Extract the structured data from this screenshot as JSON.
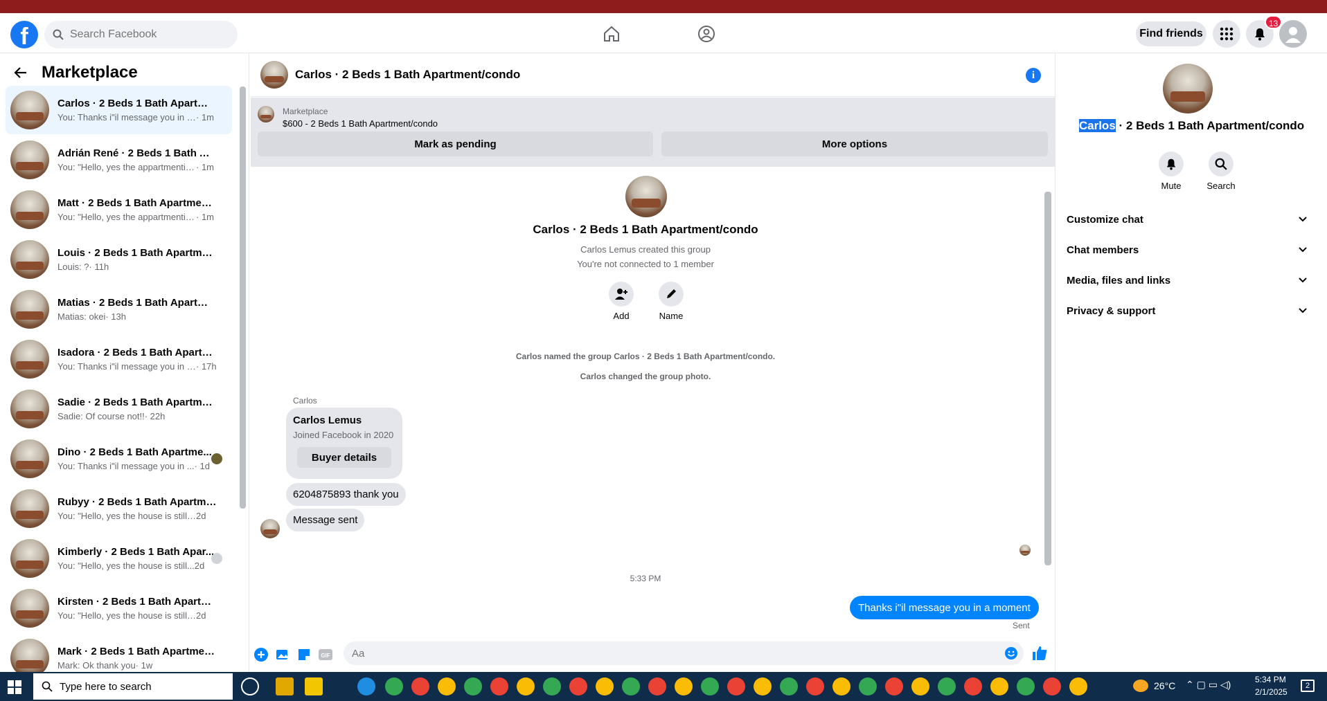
{
  "header": {
    "logo": "f",
    "search_placeholder": "Search Facebook",
    "find_friends": "Find friends",
    "notif_count": "13"
  },
  "sidebar": {
    "title": "Marketplace",
    "items": [
      {
        "name": "Carlos · 2 Beds 1 Bath Apartmen...",
        "preview": "You: Thanks i\"il message you in a ...",
        "time": " · 1m"
      },
      {
        "name": "Adrián René · 2 Beds 1 Bath Apa...",
        "preview": "You: \"Hello, yes the appartmentis s...",
        "time": " · 1m"
      },
      {
        "name": "Matt · 2 Beds 1 Bath Apartment/...",
        "preview": "You: \"Hello, yes the appartmentis s...",
        "time": " · 1m"
      },
      {
        "name": "Louis · 2 Beds 1 Bath Apartment...",
        "preview": "Louis: ?",
        "time": " · 11h"
      },
      {
        "name": "Matias · 2 Beds 1 Bath Apartme...",
        "preview": "Matias: okei",
        "time": " · 13h"
      },
      {
        "name": "Isadora · 2 Beds 1 Bath Apartme...",
        "preview": "You: Thanks i\"il message you in a ...",
        "time": " · 17h"
      },
      {
        "name": "Sadie · 2 Beds 1 Bath Apartment...",
        "preview": "Sadie: Of course not!!",
        "time": " · 22h"
      },
      {
        "name": "Dino · 2 Beds 1 Bath Apartme...",
        "preview": "You: Thanks i\"il message you in ...",
        "time": " · 1d"
      },
      {
        "name": "Rubyy · 2 Beds 1 Bath Apartmen...",
        "preview": "You: \"Hello, yes the house is still av...",
        "time": " 2d"
      },
      {
        "name": "Kimberly · 2 Beds 1 Bath Apar...",
        "preview": "You: \"Hello, yes the house is still...",
        "time": " 2d"
      },
      {
        "name": "Kirsten · 2 Beds 1 Bath Apartme...",
        "preview": "You: \"Hello, yes the house is still av...",
        "time": " 2d"
      },
      {
        "name": "Mark · 2 Beds 1 Bath Apartment...",
        "preview": "Mark: Ok thank you",
        "time": " · 1w"
      }
    ]
  },
  "chat": {
    "title": "Carlos · 2 Beds 1 Bath Apartment/condo",
    "marketplace_label": "Marketplace",
    "listing": "$600 - 2 Beds 1 Bath Apartment/condo",
    "mark_pending": "Mark as pending",
    "more_options": "More options",
    "group_title": "Carlos · 2 Beds 1 Bath Apartment/condo",
    "created": "Carlos Lemus created this group",
    "not_connected": "You're not connected to 1 member",
    "add": "Add",
    "name": "Name",
    "named_group": "Carlos named the group Carlos · 2 Beds 1 Bath Apartment/condo.",
    "changed_photo": "Carlos changed the group photo.",
    "sender": "Carlos",
    "card_name": "Carlos Lemus",
    "card_sub": "Joined Facebook in 2020",
    "buyer_details": "Buyer details",
    "msg1": "6204875893 thank you",
    "msg2": "Message sent",
    "timestamp": "5:33 PM",
    "out_msg": "Thanks i\"il message you in a moment",
    "sent": "Sent",
    "composer_placeholder": "Aa"
  },
  "details": {
    "title_highlight": "Carlos",
    "title_rest": " · 2 Beds 1 Bath Apartment/condo",
    "mute": "Mute",
    "search": "Search",
    "sections": [
      "Customize chat",
      "Chat members",
      "Media, files and links",
      "Privacy & support"
    ]
  },
  "taskbar": {
    "search_placeholder": "Type here to search",
    "weather": "26°C",
    "time": "5:34 PM",
    "date": "2/1/2025",
    "notif": "2"
  }
}
